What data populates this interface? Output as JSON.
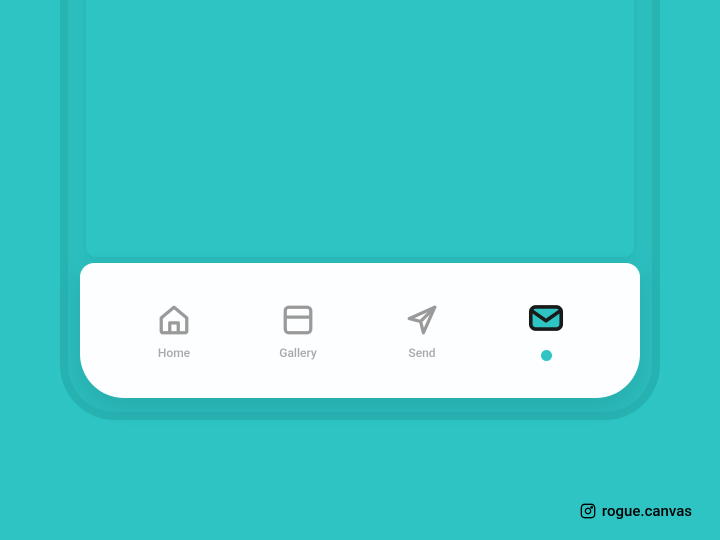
{
  "colors": {
    "background": "#2ec4c4",
    "frame": "#28b3b3",
    "navBackground": "#fcfeff",
    "inactiveIcon": "#9a9a9a",
    "activeIcon": "#1a1a1a",
    "activeFill": "#2ec4c4",
    "labelColor": "#a9a9a9"
  },
  "nav": {
    "items": [
      {
        "id": "home",
        "label": "Home",
        "icon": "home-icon",
        "active": false
      },
      {
        "id": "gallery",
        "label": "Gallery",
        "icon": "gallery-icon",
        "active": false
      },
      {
        "id": "send",
        "label": "Send",
        "icon": "send-icon",
        "active": false
      },
      {
        "id": "mail",
        "label": "",
        "icon": "mail-icon",
        "active": true
      }
    ]
  },
  "credit": {
    "handle": "rogue.canvas"
  }
}
